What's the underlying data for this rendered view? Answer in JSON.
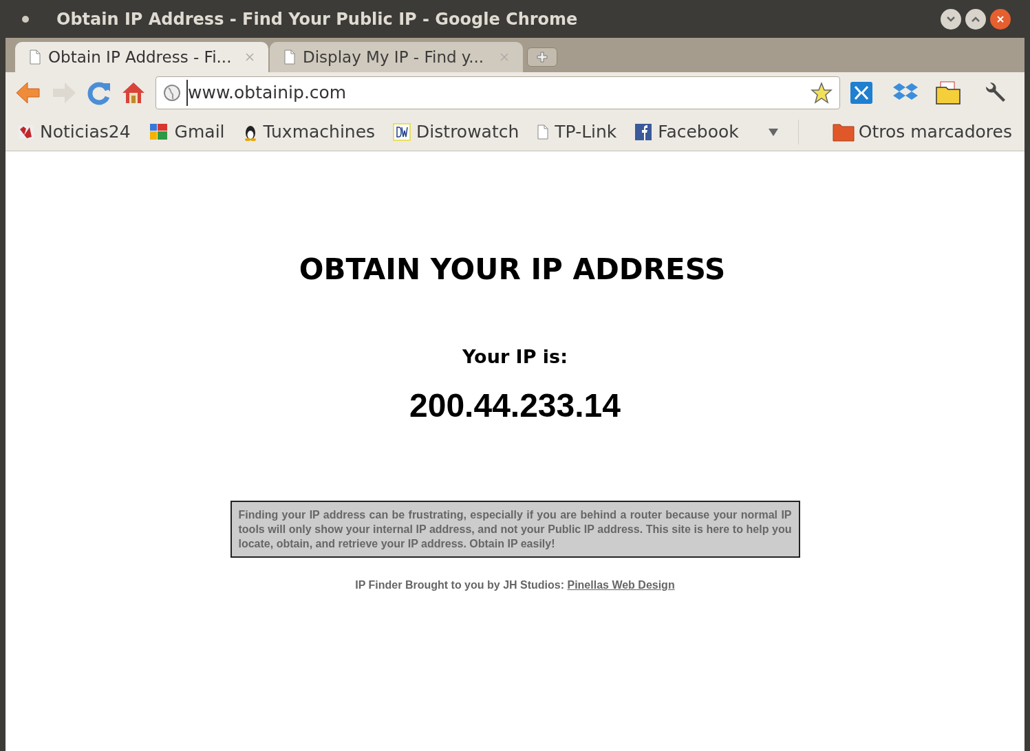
{
  "window": {
    "title": "Obtain IP Address - Find Your Public IP - Google Chrome"
  },
  "tabs": [
    {
      "label": "Obtain IP Address - Fi...",
      "selected": true
    },
    {
      "label": "Display My IP - Find y...",
      "selected": false
    }
  ],
  "address_bar": {
    "value": "www.obtainip.com"
  },
  "bookmarks": [
    {
      "label": "Noticias24",
      "kind": "n24"
    },
    {
      "label": "Gmail",
      "kind": "google"
    },
    {
      "label": "Tuxmachines",
      "kind": "tux"
    },
    {
      "label": "Distrowatch",
      "kind": "dw"
    },
    {
      "label": "TP-Link",
      "kind": "page"
    },
    {
      "label": "Facebook",
      "kind": "fb"
    }
  ],
  "other_bookmarks": "Otros marcadores",
  "page": {
    "heading": "OBTAIN YOUR IP ADDRESS",
    "ip_label": "Your IP is:",
    "ip": "200.44.233.14",
    "notice": "Finding your IP address can be frustrating, especially if you are behind a router because your normal IP tools will only show your internal IP address, and not your Public IP address. This site is here to help you locate, obtain, and retrieve your IP address. Obtain IP easily!",
    "footer_text": "IP Finder Brought to you by JH Studios:",
    "footer_link": "Pinellas Web Design"
  }
}
